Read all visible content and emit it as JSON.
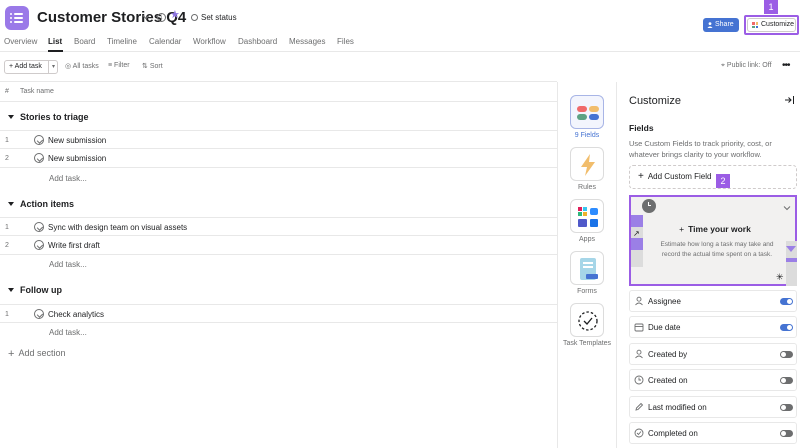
{
  "header": {
    "project_title": "Customer Stories Q4",
    "set_status": "Set status",
    "share_label": "Share",
    "customize_label": "Customize",
    "highlight_1": "1",
    "highlight_2": "2"
  },
  "tabs": [
    "Overview",
    "List",
    "Board",
    "Timeline",
    "Calendar",
    "Workflow",
    "Dashboard",
    "Messages",
    "Files"
  ],
  "active_tab": "List",
  "toolbar": {
    "add_task": "+ Add task",
    "all_tasks": "All tasks",
    "filter": "Filter",
    "sort": "Sort",
    "public_link": "Public link: Off"
  },
  "list": {
    "col_number": "#",
    "col_task_name": "Task name",
    "add_task_link": "Add task...",
    "add_section": "Add section",
    "sections": [
      {
        "title": "Stories to triage",
        "tasks": [
          {
            "num": "1",
            "name": "New submission"
          },
          {
            "num": "2",
            "name": "New submission"
          }
        ]
      },
      {
        "title": "Action items",
        "tasks": [
          {
            "num": "1",
            "name": "Sync with design team on visual assets"
          },
          {
            "num": "2",
            "name": "Write first draft"
          }
        ]
      },
      {
        "title": "Follow up",
        "tasks": [
          {
            "num": "1",
            "name": "Check analytics"
          }
        ]
      }
    ]
  },
  "rail": [
    {
      "label": "9 Fields",
      "icon": "fields-icon",
      "active": true
    },
    {
      "label": "Rules",
      "icon": "lightning-icon",
      "active": false
    },
    {
      "label": "Apps",
      "icon": "apps-icon",
      "active": false
    },
    {
      "label": "Forms",
      "icon": "forms-icon",
      "active": false
    },
    {
      "label": "Task Templates",
      "icon": "task-templates-icon",
      "active": false
    }
  ],
  "panel": {
    "title": "Customize",
    "fields_heading": "Fields",
    "fields_desc": "Use Custom Fields to track priority, cost, or whatever brings clarity to your workflow.",
    "add_custom_field": "Add Custom Field",
    "promo_title": "Time your work",
    "promo_desc": "Estimate how long a task may take and record the actual time spent on a task.",
    "fields": [
      {
        "label": "Assignee",
        "icon": "person-icon",
        "on": true
      },
      {
        "label": "Due date",
        "icon": "calendar-icon",
        "on": true
      },
      {
        "label": "Created by",
        "icon": "person-icon",
        "on": false
      },
      {
        "label": "Created on",
        "icon": "clock-icon",
        "on": false
      },
      {
        "label": "Last modified on",
        "icon": "pencil-icon",
        "on": false
      },
      {
        "label": "Completed on",
        "icon": "check-circle-icon",
        "on": false
      }
    ]
  },
  "colors": {
    "accent": "#4573d2",
    "highlight": "#9b5de5",
    "project_icon": "#9a79e8"
  }
}
